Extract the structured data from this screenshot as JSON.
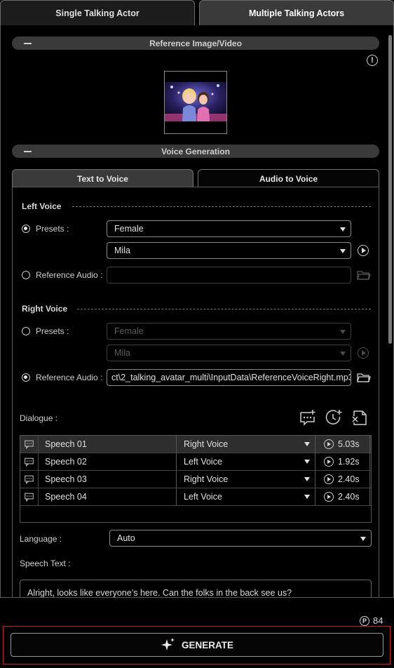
{
  "tabs": {
    "single": "Single Talking Actor",
    "multiple": "Multiple Talking Actors"
  },
  "sections": {
    "reference": "Reference Image/Video",
    "voice_generation": "Voice Generation"
  },
  "info_icon": "!",
  "voice_tabs": {
    "text": "Text to Voice",
    "audio": "Audio to Voice"
  },
  "left_voice": {
    "title": "Left Voice",
    "presets_label": "Presets :",
    "gender": "Female",
    "voice": "Mila",
    "reference_label": "Reference Audio :",
    "reference_value": "",
    "mode": "presets"
  },
  "right_voice": {
    "title": "Right Voice",
    "presets_label": "Presets :",
    "gender": "Female",
    "voice": "Mila",
    "reference_label": "Reference Audio :",
    "reference_value": "ct\\2_talking_avatar_multi\\InputData\\ReferenceVoiceRight.mp3",
    "mode": "reference"
  },
  "dialogue": {
    "label": "Dialogue :",
    "rows": [
      {
        "name": "Speech 01",
        "voice": "Right Voice",
        "duration": "5.03s",
        "selected": true
      },
      {
        "name": "Speech 02",
        "voice": "Left Voice",
        "duration": "1.92s",
        "selected": false
      },
      {
        "name": "Speech 03",
        "voice": "Right Voice",
        "duration": "2.40s",
        "selected": false
      },
      {
        "name": "Speech 04",
        "voice": "Left Voice",
        "duration": "2.40s",
        "selected": false
      }
    ]
  },
  "language": {
    "label": "Language :",
    "value": "Auto"
  },
  "speech_text": {
    "label": "Speech Text :",
    "value": "Alright, looks like everyone’s here. Can the folks in the back see us?"
  },
  "credits": {
    "icon": "P",
    "value": "84"
  },
  "generate": {
    "label": "GENERATE"
  },
  "colors": {
    "highlight_border": "#c8202a",
    "background": "#000000"
  }
}
